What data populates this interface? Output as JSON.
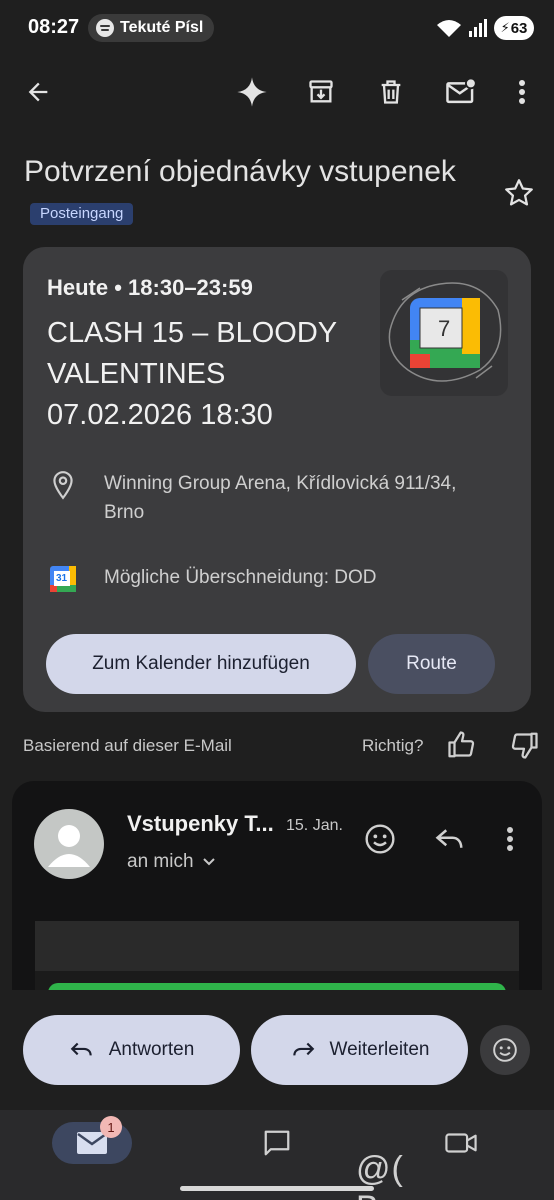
{
  "status_bar": {
    "time": "08:27",
    "media_text": "Tekuté Písl",
    "battery": "63"
  },
  "toolbar": {
    "icons": [
      "back-arrow-icon",
      "sparkle-icon",
      "archive-icon",
      "delete-icon",
      "mark-unread-icon",
      "more-vert-icon"
    ]
  },
  "email": {
    "subject": "Potvrzení objednávky vstupenek",
    "label": "Posteingang"
  },
  "event_card": {
    "when": "Heute • 18:30–23:59",
    "title": "CLASH 15 – BLOODY VALENTINES 07.02.2026 18:30",
    "calendar_day": "7",
    "location": "Winning Group Arena, Křídlovická 911/34, Brno",
    "conflict": "Mögliche Überschneidung: DOD",
    "conflict_icon_day": "31",
    "add_button": "Zum Kalender hinzufügen",
    "route_button": "Route"
  },
  "feedback": {
    "text": "Basierend auf dieser E-Mail",
    "question": "Richtig?"
  },
  "message": {
    "sender": "Vstupenky T...",
    "date": "15. Jan.",
    "recipient": "an mich"
  },
  "actions": {
    "reply": "Antworten",
    "forward": "Weiterleiten"
  },
  "nav": {
    "mail_badge": "1"
  },
  "watermark": "@( Bazos.cz",
  "colors": {
    "background": "#1f1f1f",
    "card": "#3c3c3e",
    "primary_button": "#d3d7ea",
    "label_chip": "#2b3f6e",
    "badge": "#f2b8b5"
  }
}
